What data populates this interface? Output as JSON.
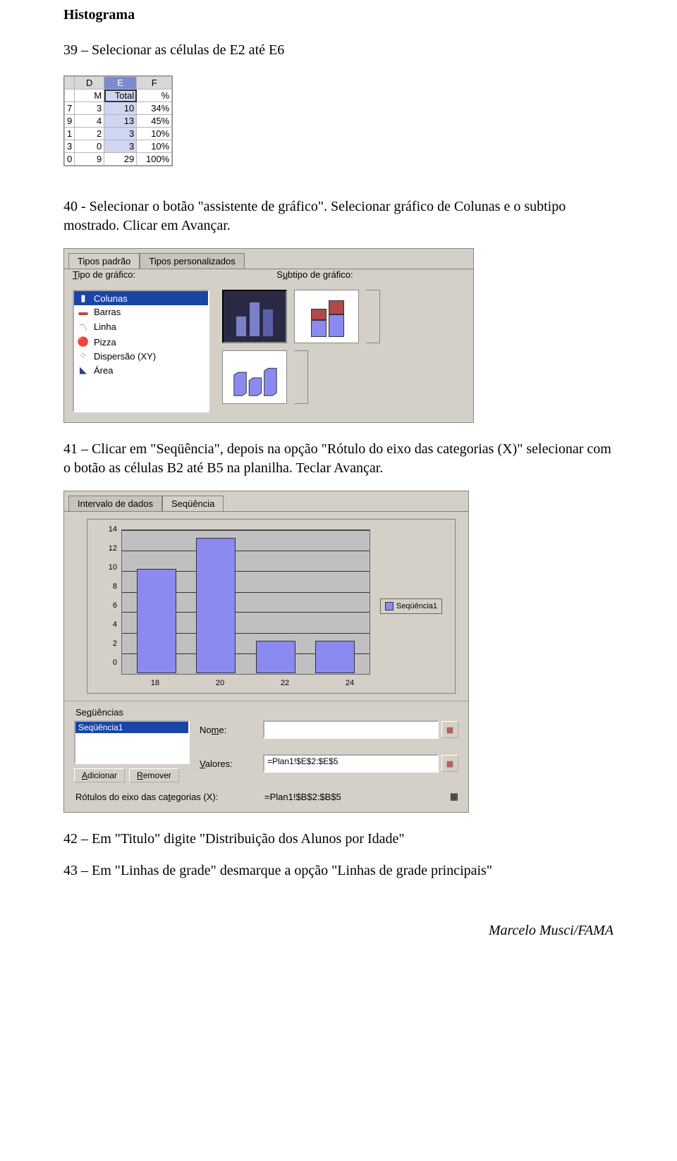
{
  "title": "Histograma",
  "step39": "39 – Selecionar as células de E2 até E6",
  "step40": "40 - Selecionar o botão \"assistente de gráfico\". Selecionar gráfico de Colunas e o subtipo mostrado. Clicar em Avançar.",
  "step41": "41 – Clicar em \"Seqüência\", depois na opção \"Rótulo do eixo das categorias (X)\" selecionar com o botão as células B2 até B5 na planilha. Teclar Avançar.",
  "step42": "42 – Em \"Titulo\" digite \"Distribuição dos Alunos por Idade\"",
  "step43": "43 – Em \"Linhas de grade\" desmarque a opção \"Linhas de grade principais\"",
  "footer": "Marcelo Musci/FAMA",
  "sheet": {
    "cols": [
      "D",
      "E",
      "F"
    ],
    "head": [
      "M",
      "Total",
      "%"
    ],
    "rowC": [
      "7",
      "9",
      "1",
      "3",
      "0"
    ],
    "rows": [
      {
        "d": "3",
        "e": "10",
        "f": "34%"
      },
      {
        "d": "4",
        "e": "13",
        "f": "45%"
      },
      {
        "d": "2",
        "e": "3",
        "f": "10%"
      },
      {
        "d": "0",
        "e": "3",
        "f": "10%"
      },
      {
        "d": "9",
        "e": "29",
        "f": "100%"
      }
    ]
  },
  "dlg1": {
    "tabs": [
      "Tipos padrão",
      "Tipos personalizados"
    ],
    "label_type": "Tipo de gráfico:",
    "label_subtype": "Subtipo de gráfico:",
    "types": [
      "Colunas",
      "Barras",
      "Linha",
      "Pizza",
      "Dispersão (XY)",
      "Área"
    ]
  },
  "dlg2": {
    "tabs": [
      "Intervalo de dados",
      "Seqüência"
    ],
    "seq_label": "Seqüências",
    "series_item": "Seqüência1",
    "name_label": "Nome:",
    "name_value": "",
    "values_label": "Valores:",
    "values_value": "=Plan1!$E$2:$E$5",
    "add_btn": "Adicionar",
    "remove_btn": "Remover",
    "cat_label": "Rótulos do eixo das categorias (X):",
    "cat_value": "=Plan1!$B$2:$B$5",
    "legend": "Seqüência1"
  },
  "chart_data": {
    "type": "bar",
    "categories": [
      "18",
      "20",
      "22",
      "24"
    ],
    "values": [
      10,
      13,
      3,
      3
    ],
    "title": "",
    "xlabel": "",
    "ylabel": "",
    "ylim": [
      0,
      14
    ],
    "yticks": [
      0,
      2,
      4,
      6,
      8,
      10,
      12,
      14
    ],
    "legend": [
      "Seqüência1"
    ]
  }
}
